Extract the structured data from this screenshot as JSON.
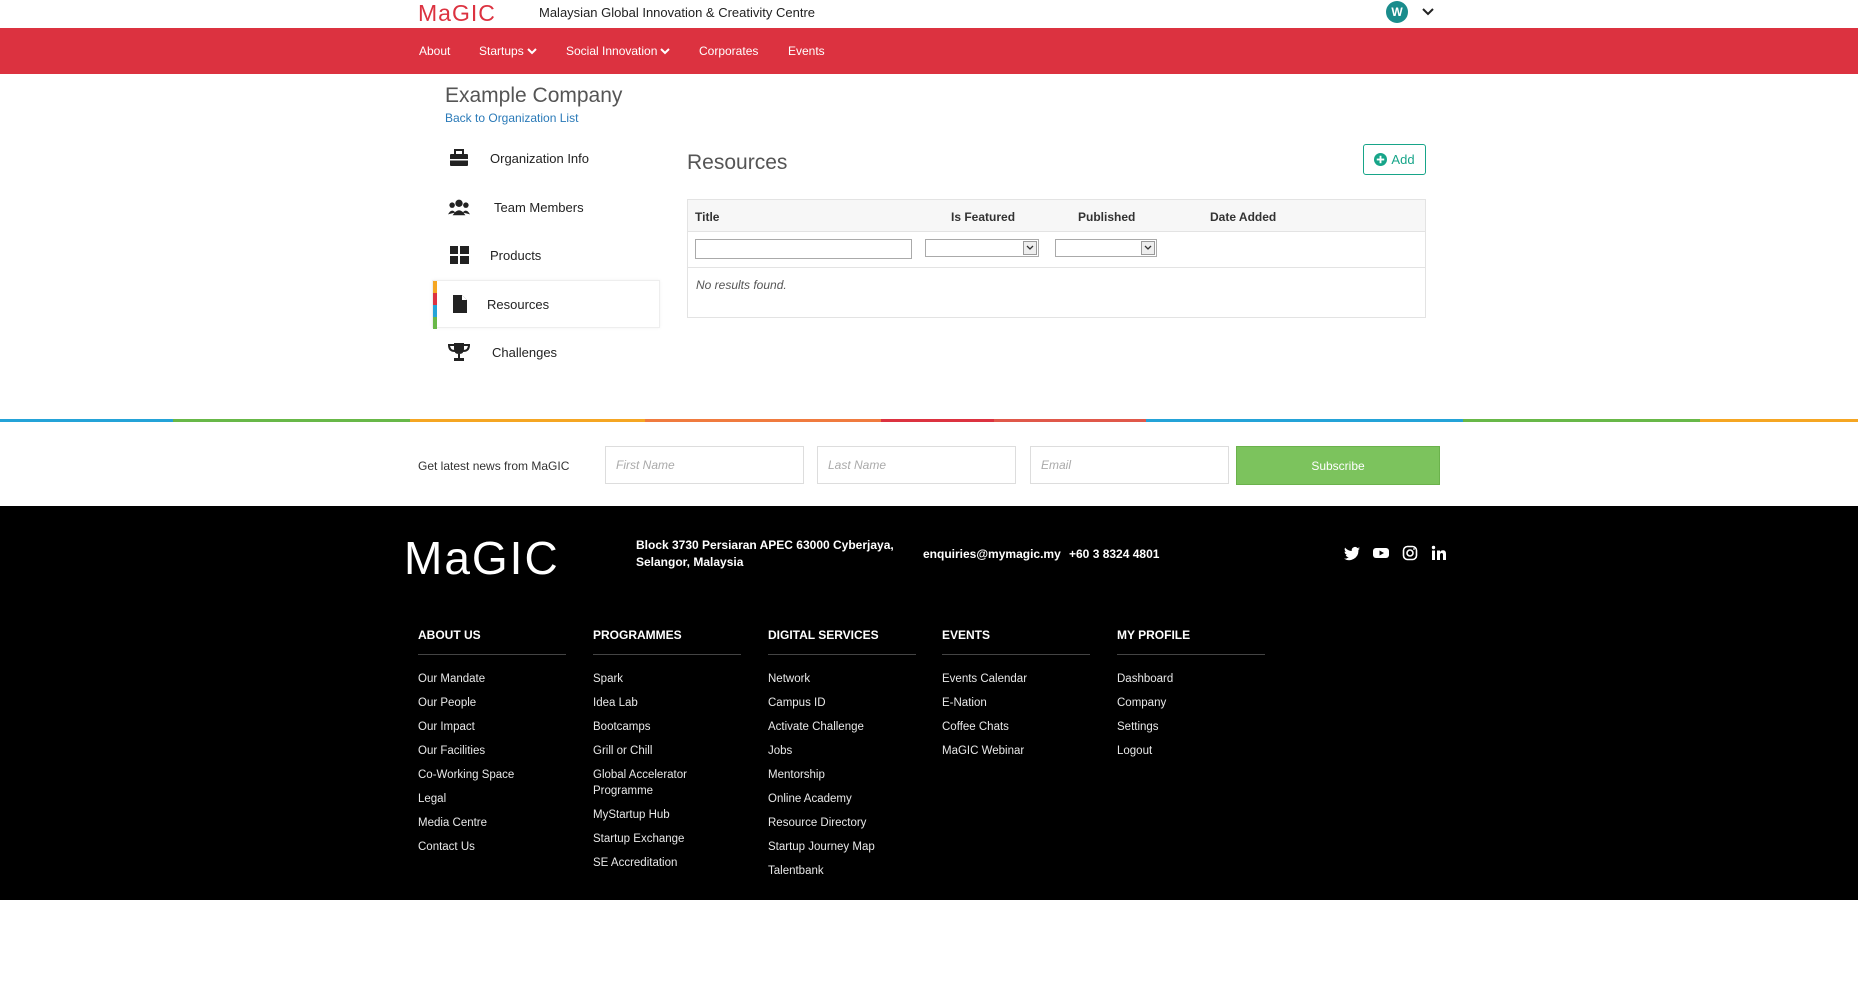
{
  "header": {
    "logo_text": "MaGIC",
    "site_title": "Malaysian Global Innovation & Creativity Centre",
    "avatar_initial": "W"
  },
  "nav": {
    "items": [
      {
        "label": "About"
      },
      {
        "label": "Startups"
      },
      {
        "label": "Social Innovation"
      },
      {
        "label": "Corporates"
      },
      {
        "label": "Events"
      }
    ]
  },
  "company": {
    "name": "Example Company",
    "back_link": "Back to Organization List"
  },
  "sidebar": {
    "items": [
      {
        "label": "Organization Info",
        "icon": "briefcase-icon"
      },
      {
        "label": "Team Members",
        "icon": "users-icon"
      },
      {
        "label": "Products",
        "icon": "grid-icon"
      },
      {
        "label": "Resources",
        "icon": "file-icon",
        "active": true
      },
      {
        "label": "Challenges",
        "icon": "trophy-icon"
      }
    ]
  },
  "resources": {
    "title": "Resources",
    "add_label": "Add",
    "columns": [
      "Title",
      "Is Featured",
      "Published",
      "Date Added"
    ],
    "empty_message": "No results found."
  },
  "newsletter": {
    "label": "Get latest news from MaGIC",
    "first_name_placeholder": "First Name",
    "last_name_placeholder": "Last Name",
    "email_placeholder": "Email",
    "subscribe_label": "Subscribe"
  },
  "footer": {
    "logo_text": "MaGIC",
    "address_line1": "Block 3730 Persiaran APEC 63000 Cyberjaya,",
    "address_line2": "Selangor, Malaysia",
    "email": "enquiries@mymagic.my",
    "phone": "+60 3 8324 4801",
    "socials": [
      "twitter-icon",
      "youtube-icon",
      "instagram-icon",
      "linkedin-icon"
    ],
    "columns": [
      {
        "heading": "ABOUT US",
        "links": [
          "Our Mandate",
          "Our People",
          "Our Impact",
          "Our Facilities",
          "Co-Working Space",
          "Legal",
          "Media Centre",
          "Contact Us"
        ]
      },
      {
        "heading": "PROGRAMMES",
        "links": [
          "Spark",
          "Idea Lab",
          "Bootcamps",
          "Grill or Chill",
          "Global Accelerator Programme",
          "MyStartup Hub",
          "Startup Exchange",
          "SE Accreditation"
        ]
      },
      {
        "heading": "DIGITAL SERVICES",
        "links": [
          "Network",
          "Campus ID",
          "Activate Challenge",
          "Jobs",
          "Mentorship",
          "Online Academy",
          "Resource Directory",
          "Startup Journey Map",
          "Talentbank"
        ]
      },
      {
        "heading": "EVENTS",
        "links": [
          "Events Calendar",
          "E-Nation",
          "Coffee Chats",
          "MaGIC Webinar"
        ]
      },
      {
        "heading": "MY PROFILE",
        "links": [
          "Dashboard",
          "Company",
          "Settings",
          "Logout"
        ]
      }
    ]
  },
  "colors": {
    "brand_red": "#dc3240",
    "accent_green": "#7cc35d",
    "add_teal": "#17a589",
    "link_blue": "#2a7ab8"
  }
}
